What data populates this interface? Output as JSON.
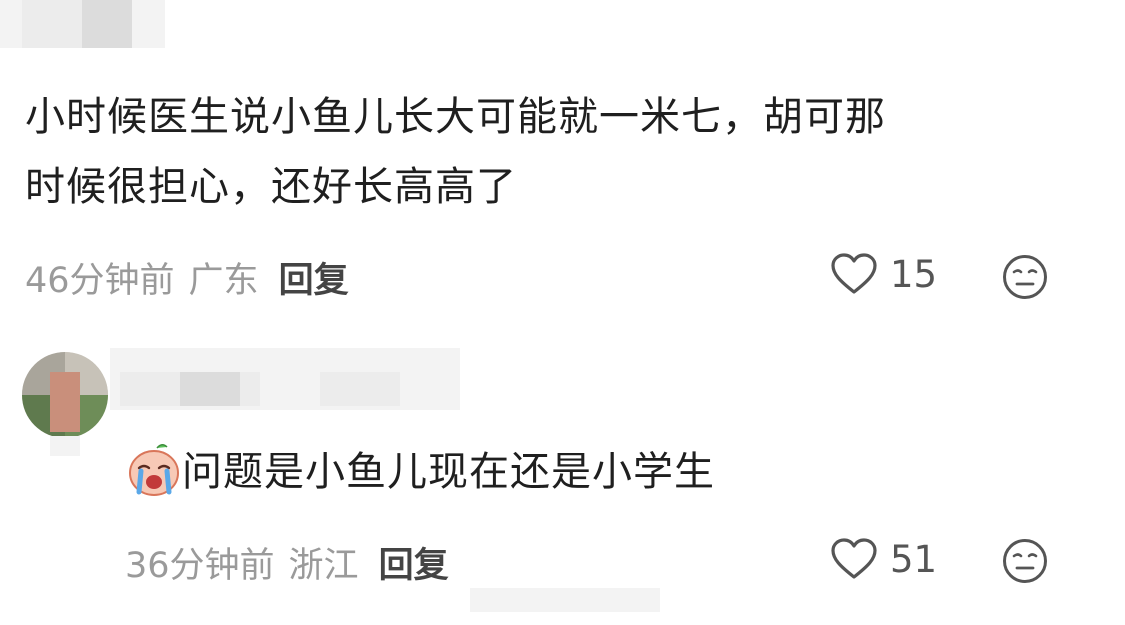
{
  "comment1": {
    "text_line1": "小时候医生说小鱼儿长大可能就一米七，胡可那",
    "text_line2": "时候很担心，还好长高高了",
    "time": "46分钟前",
    "location": "广东",
    "reply_label": "回复",
    "likes": "15"
  },
  "comment2": {
    "emoji": "crying-face-emoji",
    "text": "问题是小鱼儿现在还是小学生",
    "time": "36分钟前",
    "location": "浙江",
    "reply_label": "回复",
    "likes": "51"
  },
  "icons": {
    "like": "heart-outline-icon",
    "dislike": "meh-face-icon"
  },
  "colors": {
    "meta_gray": "#9a9a9a",
    "icon_gray": "#555555",
    "text": "#1f1f1f"
  }
}
